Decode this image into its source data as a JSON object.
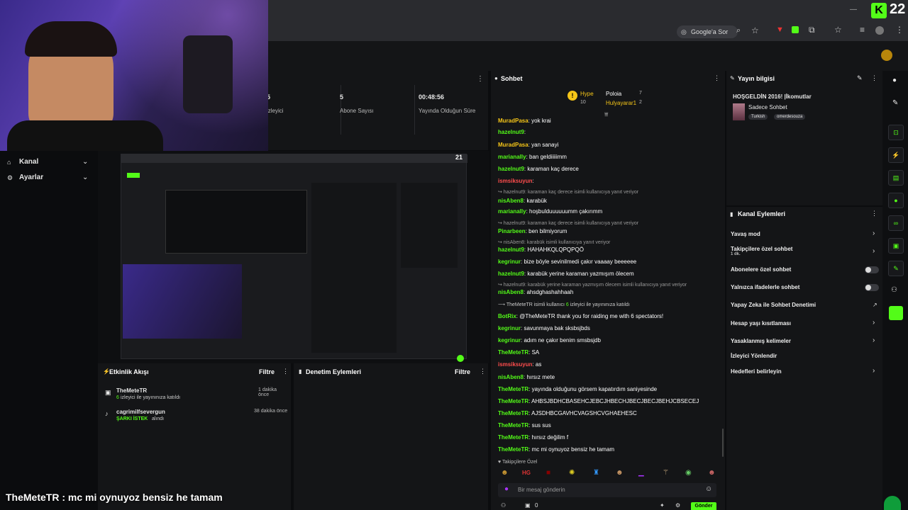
{
  "browser": {
    "search_label": "Google'a Sor",
    "kick_badge": "22"
  },
  "left_nav": [
    {
      "label": "Kanal"
    },
    {
      "label": "Ayarlar"
    }
  ],
  "stats": [
    {
      "value": "5",
      "label": "izleyici"
    },
    {
      "value": "5",
      "label": "Abone Sayısı"
    },
    {
      "value": "00:48:56",
      "label": "Yayında Olduğun Süre"
    }
  ],
  "preview_badge": "21",
  "activity": {
    "title": "Etkinlik Akışı",
    "filter": "Filtre",
    "items": [
      {
        "user": "TheMeteTR",
        "detail_count": "6",
        "detail": "izleyici ile yayınınıza katıldı",
        "time": "1 dakika önce"
      },
      {
        "user": "cagrimilfsevergun",
        "detail_tag": "ŞARKI İSTEK",
        "detail": "alındı",
        "time": "38 dakika önce"
      }
    ]
  },
  "moderation": {
    "title": "Denetim Eylemleri",
    "filter": "Filtre"
  },
  "chat": {
    "title": "Sohbet",
    "top": {
      "hype": "Hype",
      "hype_count": "10",
      "user1": "Poloia",
      "user1_count": "7",
      "user2": "Hulyayarar1",
      "user2_count": "2"
    },
    "messages": [
      {
        "user": "MuradPasa",
        "color": "#f5c518",
        "text": "yok krai"
      },
      {
        "user": "hazelnut9",
        "color": "#53fc18",
        "text": ""
      },
      {
        "user": "MuradPasa",
        "color": "#f5c518",
        "text": "yan sanayi"
      },
      {
        "user": "marianally",
        "color": "#53fc18",
        "text": "ban geldiiiiimm"
      },
      {
        "user": "hazelnut9",
        "color": "#53fc18",
        "text": "karaman kaç derece"
      },
      {
        "user": "ismsiksuyun",
        "color": "#ff4d4d",
        "text": ""
      },
      {
        "reply": "hazelnut9: karaman kaç derece isimli kullanıcıya yanıt veriyor"
      },
      {
        "user": "nisAben8",
        "color": "#53fc18",
        "text": "karabük"
      },
      {
        "user": "marianally",
        "color": "#53fc18",
        "text": "hoşbulduuuuuumm çakırımm"
      },
      {
        "reply": "hazelnut9: karaman kaç derece isimli kullanıcıya yanıt veriyor"
      },
      {
        "user": "Pinarbeen",
        "color": "#53fc18",
        "text": "ben bilmiyorum"
      },
      {
        "reply": "nisAben8: karabük isimli kullanıcıya yanıt veriyor"
      },
      {
        "user": "hazelnut9",
        "color": "#53fc18",
        "text": "HAHAHKQLQPQPQÖ"
      },
      {
        "user": "kegrinur",
        "color": "#53fc18",
        "text": "bize böyle sevinilmedi çakır vaaaay beeeeee"
      },
      {
        "user": "hazelnut9",
        "color": "#53fc18",
        "text": "karabük yerine karaman yazmışım ölecem"
      },
      {
        "reply": "hazelnut9: karabük yerine karaman yazmışım ölecem isimli kullanıcıya yanıt veriyor"
      },
      {
        "user": "nisAben8",
        "color": "#53fc18",
        "text": "ahsdghashahhaah"
      },
      {
        "raid": "TheMeteTR isimli kullanıcı",
        "raid_count": "6",
        "raid_tail": "izleyici ile yayınınıza katıldı"
      },
      {
        "user": "BotRix",
        "color": "#53fc18",
        "text": "@TheMeteTR thank you for raiding me with 6 spectators!"
      },
      {
        "user": "kegrinur",
        "color": "#53fc18",
        "text": "savunmaya bak sksbsjbds"
      },
      {
        "user": "kegrinur",
        "color": "#53fc18",
        "text": "adım ne çakır benim smsbsjdb"
      },
      {
        "user": "TheMeteTR",
        "color": "#53fc18",
        "text": "SA"
      },
      {
        "user": "ismsiksuyun",
        "color": "#ff4d4d",
        "text": "as"
      },
      {
        "user": "nisAben8",
        "color": "#53fc18",
        "text": "hırsız mete"
      },
      {
        "user": "TheMeteTR",
        "color": "#53fc18",
        "text": "yayında olduğunu görsem kapatırdım saniyesinde"
      },
      {
        "user": "TheMeteTR",
        "color": "#53fc18",
        "text": "AHBSJBDHCBASEHCJEBCJHBECHJBECJBECJBEHJCBSECEJ"
      },
      {
        "user": "TheMeteTR",
        "color": "#53fc18",
        "text": "AJSDHBCGAVHCVAGSHCVGHAEHESC"
      },
      {
        "user": "TheMeteTR",
        "color": "#53fc18",
        "text": "sus sus"
      },
      {
        "user": "TheMeteTR",
        "color": "#53fc18",
        "text": "hırsız değilim f"
      },
      {
        "user": "TheMeteTR",
        "color": "#53fc18",
        "text": "mc mi oynuyoz bensiz he tamam"
      }
    ],
    "followers_only": "Takipçilere Özel",
    "input_placeholder": "Bir mesaj gönderin",
    "send": "Gönder",
    "viewer_count": "0"
  },
  "stream_info": {
    "title": "Yayın bilgisi",
    "stream_title": "HOŞGELDİN 2016! |İkomutlar",
    "category": "Sadece Sohbet",
    "tags": [
      "Turkish",
      "omerdesouza"
    ]
  },
  "channel_actions": {
    "title": "Kanal Eylemleri",
    "items": [
      {
        "label": "Yavaş mod",
        "control": "chevron"
      },
      {
        "label": "Takipçilere özel sohbet",
        "sub": "1 dk.",
        "control": "chevron"
      },
      {
        "label": "Abonelere özel sohbet",
        "control": "toggle"
      },
      {
        "label": "Yalnızca ifadelerle sohbet",
        "control": "toggle"
      },
      {
        "label": "Yapay Zeka ile Sohbet Denetimi",
        "control": "external"
      },
      {
        "label": "Hesap yaşı kısıtlaması",
        "control": "chevron"
      },
      {
        "label": "Yasaklanmış kelimeler",
        "control": "chevron"
      },
      {
        "label": "İzleyici Yönlendir",
        "control": "none"
      },
      {
        "label": "Hedefleri belirleyin",
        "control": "chevron"
      }
    ]
  },
  "overlay_caption": {
    "user": "TheMeteTR",
    "text": "mc mi oynuyoz bensiz he tamam"
  },
  "colors": {
    "accent": "#53fc18",
    "panel": "#141517",
    "bg": "#0b0c0e"
  }
}
